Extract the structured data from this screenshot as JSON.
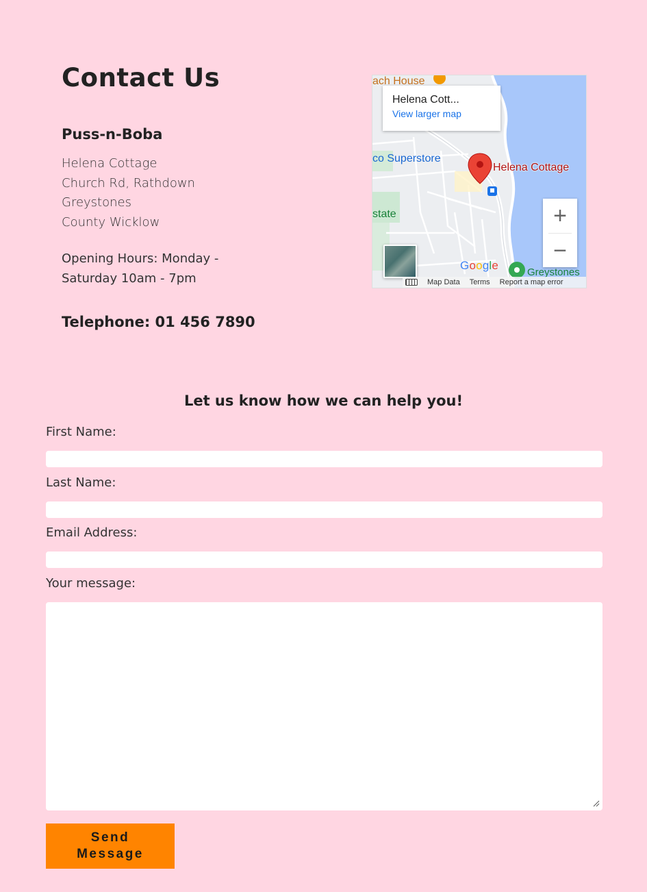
{
  "page": {
    "title": "Contact Us"
  },
  "business": {
    "name": "Puss-n-Boba",
    "address_lines": [
      "Helena Cottage",
      "Church Rd, Rathdown",
      "Greystones",
      "County Wicklow"
    ],
    "hours": "Opening Hours: Monday - Saturday 10am - 7pm",
    "telephone": "Telephone: 01 456 7890"
  },
  "map": {
    "infocard_place": "Helena Cott...",
    "infocard_link": "View larger map",
    "labels": {
      "top": "ach House",
      "superstore": "co Superstore",
      "pin": "Helena Cottage",
      "state": "state",
      "greystones": "Greystones"
    },
    "zoom_in": "+",
    "zoom_out": "−",
    "google_logo": [
      "G",
      "o",
      "o",
      "g",
      "l",
      "e"
    ],
    "footer": {
      "map_data": "Map Data",
      "terms": "Terms",
      "report": "Report a map error"
    },
    "colors": {
      "water": "#a8c7fa",
      "land": "#e8eaed",
      "pin": "#ea4335",
      "link": "#1a73e8"
    }
  },
  "form": {
    "heading": "Let us know how we can help you!",
    "first_name_label": "First Name:",
    "last_name_label": "Last Name:",
    "email_label": "Email Address:",
    "message_label": "Your message:",
    "first_name_value": "",
    "last_name_value": "",
    "email_value": "",
    "message_value": "",
    "submit_label": "Send Message",
    "submit_color": "#ff8400"
  },
  "theme": {
    "background": "#ffd6e2"
  }
}
